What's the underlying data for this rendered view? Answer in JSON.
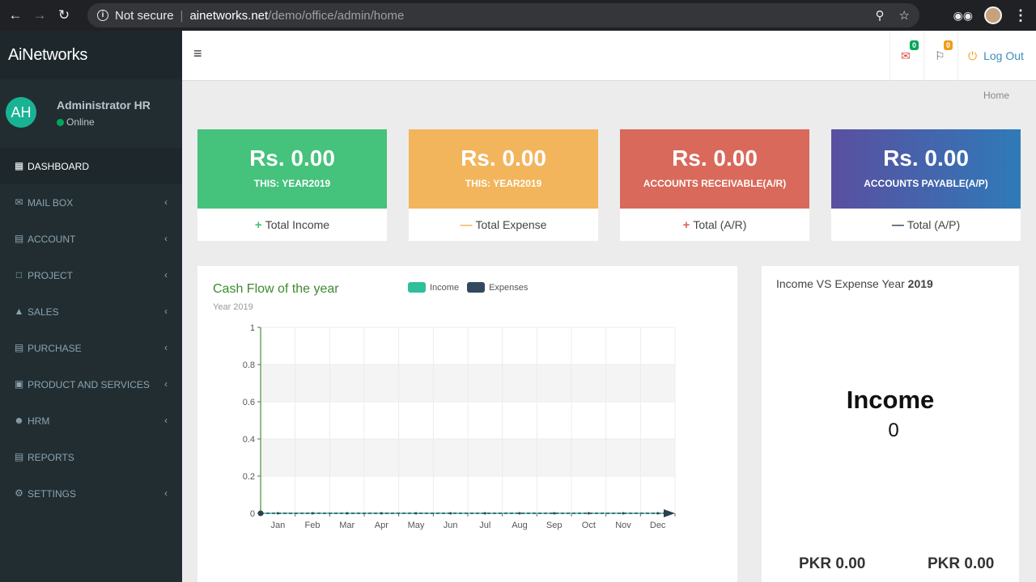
{
  "browser": {
    "security_label": "Not secure",
    "url_domain": "ainetworks.net",
    "url_path": "/demo/office/admin/home"
  },
  "sidebar": {
    "brand": "AiNetworks",
    "user": {
      "initials": "AH",
      "name": "Administrator HR",
      "status": "Online"
    },
    "items": [
      {
        "label": "DASHBOARD",
        "icon": "dashboard-icon",
        "active": true,
        "chevron": false
      },
      {
        "label": "MAIL BOX",
        "icon": "mail-icon",
        "chevron": true
      },
      {
        "label": "ACCOUNT",
        "icon": "account-icon",
        "chevron": true
      },
      {
        "label": "PROJECT",
        "icon": "project-icon",
        "chevron": true
      },
      {
        "label": "SALES",
        "icon": "basket-icon",
        "chevron": true
      },
      {
        "label": "PURCHASE",
        "icon": "cart-icon",
        "chevron": true
      },
      {
        "label": "PRODUCT AND SERVICES",
        "icon": "product-icon",
        "chevron": true
      },
      {
        "label": "HRM",
        "icon": "user-icon",
        "chevron": true
      },
      {
        "label": "REPORTS",
        "icon": "report-icon",
        "chevron": false
      },
      {
        "label": "SETTINGS",
        "icon": "gear-icon",
        "chevron": true
      }
    ]
  },
  "topnav": {
    "mail_badge": "0",
    "flag_badge": "0",
    "logout_label": "Log Out"
  },
  "breadcrumb": "Home",
  "cards": [
    {
      "amount": "Rs. 0.00",
      "caption": "THIS: YEAR2019",
      "sign": "+",
      "footer": "Total Income",
      "color": "#45c27b",
      "sign_color": "#45c27b"
    },
    {
      "amount": "Rs. 0.00",
      "caption": "THIS: YEAR2019",
      "sign": "—",
      "footer": "Total Expense",
      "color": "#f2b55c",
      "sign_color": "#f2b55c"
    },
    {
      "amount": "Rs. 0.00",
      "caption": "ACCOUNTS RECEIVABLE(A/R)",
      "sign": "+",
      "footer": "Total (A/R)",
      "color": "#d9695a",
      "sign_color": "#d9695a"
    },
    {
      "amount": "Rs. 0.00",
      "caption": "ACCOUNTS PAYABLE(A/P)",
      "sign": "—",
      "footer": "Total (A/P)",
      "color": "#4a5aa3",
      "sign_color": "#3a4a63"
    }
  ],
  "cashflow": {
    "title": "Cash Flow of the year",
    "subtitle": "Year 2019",
    "legend": [
      {
        "name": "Income",
        "color": "#2fbf9b"
      },
      {
        "name": "Expenses",
        "color": "#34495e"
      }
    ]
  },
  "chart_data": {
    "type": "line",
    "categories": [
      "Jan",
      "Feb",
      "Mar",
      "Apr",
      "May",
      "Jun",
      "Jul",
      "Aug",
      "Sep",
      "Oct",
      "Nov",
      "Dec"
    ],
    "series": [
      {
        "name": "Income",
        "values": [
          0,
          0,
          0,
          0,
          0,
          0,
          0,
          0,
          0,
          0,
          0,
          0
        ]
      },
      {
        "name": "Expenses",
        "values": [
          0,
          0,
          0,
          0,
          0,
          0,
          0,
          0,
          0,
          0,
          0,
          0
        ]
      }
    ],
    "yticks": [
      "0",
      "0.2",
      "0.4",
      "0.6",
      "0.8",
      "1"
    ],
    "ylim": [
      0,
      1
    ],
    "grid": true
  },
  "income_vs_expense": {
    "title_prefix": "Income VS Expense Year",
    "year": "2019",
    "center_label": "Income",
    "center_value": "0",
    "income_total": "PKR 0.00",
    "expense_total": "PKR 0.00"
  }
}
